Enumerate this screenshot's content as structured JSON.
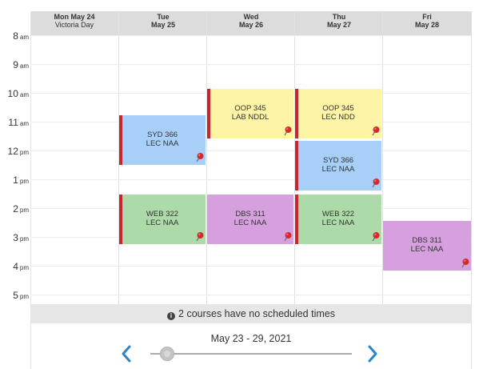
{
  "days": [
    {
      "dow_date": "Mon May 24",
      "holiday": "Victoria Day"
    },
    {
      "dow_date": "Tue",
      "holiday": "May 25"
    },
    {
      "dow_date": "Wed",
      "holiday": "May 26"
    },
    {
      "dow_date": "Thu",
      "holiday": "May 27"
    },
    {
      "dow_date": "Fri",
      "holiday": "May 28"
    }
  ],
  "hours": [
    {
      "num": "8",
      "ap": "am"
    },
    {
      "num": "9",
      "ap": "am"
    },
    {
      "num": "10",
      "ap": "am"
    },
    {
      "num": "11",
      "ap": "am"
    },
    {
      "num": "12",
      "ap": "pm"
    },
    {
      "num": "1",
      "ap": "pm"
    },
    {
      "num": "2",
      "ap": "pm"
    },
    {
      "num": "3",
      "ap": "pm"
    },
    {
      "num": "4",
      "ap": "pm"
    },
    {
      "num": "5",
      "ap": "pm"
    }
  ],
  "events": [
    {
      "line1": "SYD 366",
      "line2": "LEC NAA"
    },
    {
      "line1": "WEB 322",
      "line2": "LEC NAA"
    },
    {
      "line1": "OOP 345",
      "line2": "LAB NDDL"
    },
    {
      "line1": "DBS 311",
      "line2": "LEC NAA"
    },
    {
      "line1": "OOP 345",
      "line2": "LEC NDD"
    },
    {
      "line1": "SYD 366",
      "line2": "LEC NAA"
    },
    {
      "line1": "WEB 322",
      "line2": "LEC NAA"
    },
    {
      "line1": "DBS 311",
      "line2": "LEC NAA"
    }
  ],
  "colors": {
    "blue": "#a7cff7",
    "yellow": "#fdf5a5",
    "green": "#acdaa8",
    "purple": "#d6a0de",
    "accent_bar": "#c8262c",
    "nav_arrow": "#2a84c6"
  },
  "unscheduled_note": "2 courses have no scheduled times",
  "date_range": "May 23 - 29, 2021",
  "icons": {
    "info": "info-circle-icon",
    "pin": "pushpin-icon",
    "prev": "chevron-left-icon",
    "next": "chevron-right-icon"
  }
}
